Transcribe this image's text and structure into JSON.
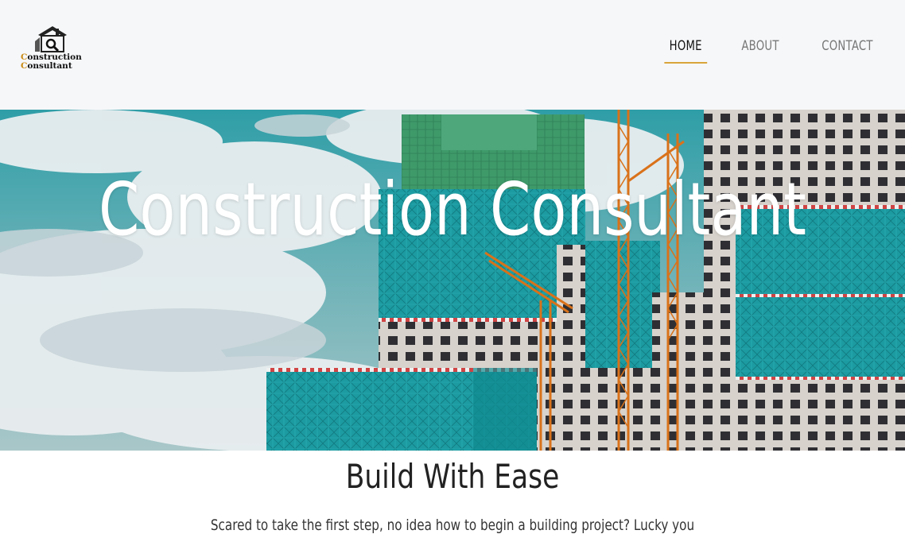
{
  "brand": {
    "line1_cap": "C",
    "line1_rest": "onstruction",
    "line2_cap": "C",
    "line2_rest": "onsultant",
    "accent_color": "#c98a12"
  },
  "nav": {
    "items": [
      {
        "label": "HOME",
        "active": true
      },
      {
        "label": "ABOUT",
        "active": false
      },
      {
        "label": "CONTACT",
        "active": false
      }
    ],
    "active_underline_color": "#d9a53b"
  },
  "hero": {
    "title": "Construction Consultant",
    "image_icon": "construction-site-photo"
  },
  "intro": {
    "title": "Build With Ease",
    "body": "Scared to take the first step, no idea how to begin a building project? Lucky you"
  }
}
